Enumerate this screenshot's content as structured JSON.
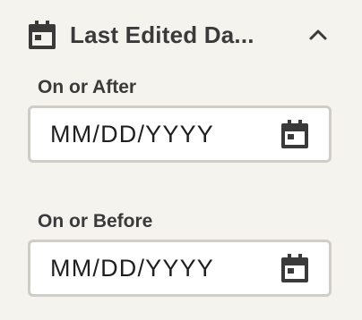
{
  "filter": {
    "title": "Last Edited Da...",
    "header_icon": "calendar-icon",
    "collapse_icon": "chevron-up-icon",
    "after": {
      "label": "On or After",
      "placeholder": "MM/DD/YYYY",
      "icon": "calendar-icon"
    },
    "before": {
      "label": "On or Before",
      "placeholder": "MM/DD/YYYY",
      "icon": "calendar-icon"
    }
  },
  "colors": {
    "background": "#f5f3ee",
    "text": "#3a3a3a",
    "input_border": "#d0cdc8",
    "input_background": "#ffffff",
    "icon": "#3a3a3a"
  }
}
